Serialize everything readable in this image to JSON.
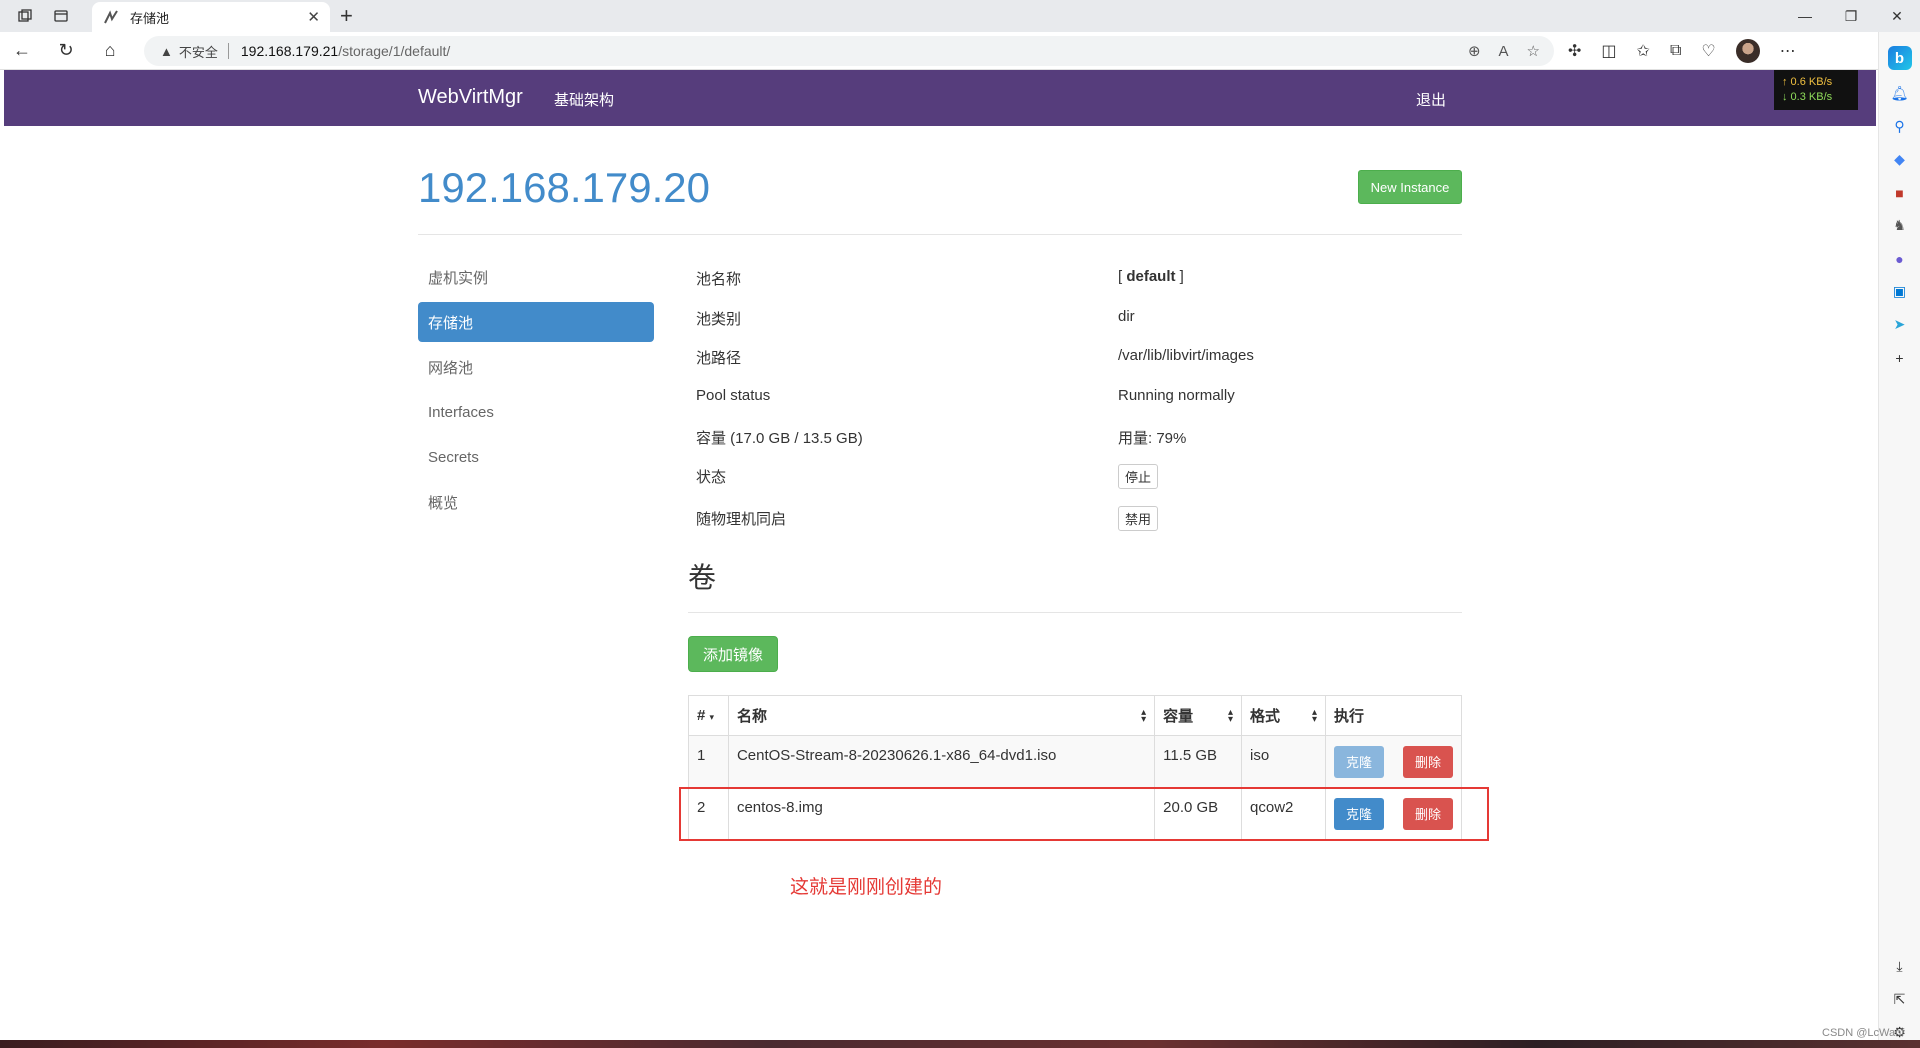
{
  "browser": {
    "tab_title": "存储池",
    "url_warning": "不安全",
    "url_host": "192.168.179.21",
    "url_path": "/storage/1/default/",
    "netspeed_up": "↑ 0.6 KB/s",
    "netspeed_down": "↓ 0.3 KB/s"
  },
  "navbar": {
    "brand": "WebVirtMgr",
    "infra": "基础架构",
    "logout": "退出"
  },
  "page": {
    "title": "192.168.179.20",
    "new_instance": "New Instance"
  },
  "sidebar": {
    "items": [
      {
        "label": "虚机实例",
        "active": false
      },
      {
        "label": "存储池",
        "active": true
      },
      {
        "label": "网络池",
        "active": false
      },
      {
        "label": "Interfaces",
        "active": false
      },
      {
        "label": "Secrets",
        "active": false
      },
      {
        "label": "概览",
        "active": false
      }
    ]
  },
  "pool": {
    "name_label": "池名称",
    "name_value": "[ default ]",
    "type_label": "池类别",
    "type_value": "dir",
    "path_label": "池路径",
    "path_value": "/var/lib/libvirt/images",
    "status_label": "Pool status",
    "status_value": "Running normally",
    "capacity_label": "容量 (17.0 GB / 13.5 GB)",
    "usage_value": "用量: 79%",
    "state_label": "状态",
    "state_button": "停止",
    "autostart_label": "随物理机同启",
    "autostart_button": "禁用"
  },
  "volumes": {
    "title": "卷",
    "add_button": "添加镜像",
    "headers": [
      "#",
      "名称",
      "容量",
      "格式",
      "执行"
    ],
    "rows": [
      {
        "num": "1",
        "name": "CentOS-Stream-8-20230626.1-x86_64-dvd1.iso",
        "size": "11.5 GB",
        "format": "iso",
        "clone": "克隆",
        "delete": "删除"
      },
      {
        "num": "2",
        "name": "centos-8.img",
        "size": "20.0 GB",
        "format": "qcow2",
        "clone": "克隆",
        "delete": "删除"
      }
    ]
  },
  "annotation": {
    "note": "这就是刚刚创建的",
    "color": "#e53935"
  },
  "watermark": "CSDN @LcWanf",
  "colors": {
    "navbar": "#563d7c",
    "primary": "#428bca",
    "success": "#5cb85c",
    "danger": "#d9534f"
  }
}
